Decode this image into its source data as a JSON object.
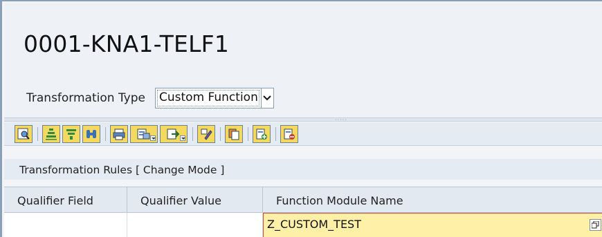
{
  "header": {
    "title": "0001-KNA1-TELF1",
    "transformation_type_label": "Transformation Type",
    "transformation_type_value": "Custom Function"
  },
  "toolbar": {
    "icons": [
      "details-icon",
      "sort-ascending-icon",
      "filter-icon",
      "find-icon",
      "print-icon",
      "layout-icon",
      "export-icon",
      "edit-icon",
      "copy-icon",
      "insert-row-icon",
      "delete-row-icon"
    ]
  },
  "rules": {
    "title": "Transformation Rules [ Change Mode ]",
    "columns": [
      "Qualifier Field",
      "Qualifier Value",
      "Function Module Name"
    ],
    "rows": [
      {
        "qualifier_field": "",
        "qualifier_value": "",
        "function_module_name": "Z_CUSTOM_TEST"
      }
    ]
  },
  "colors": {
    "accent_button": "#f3d95f",
    "required_field_border": "#d84a3f",
    "input_highlight": "#fff0a8"
  }
}
